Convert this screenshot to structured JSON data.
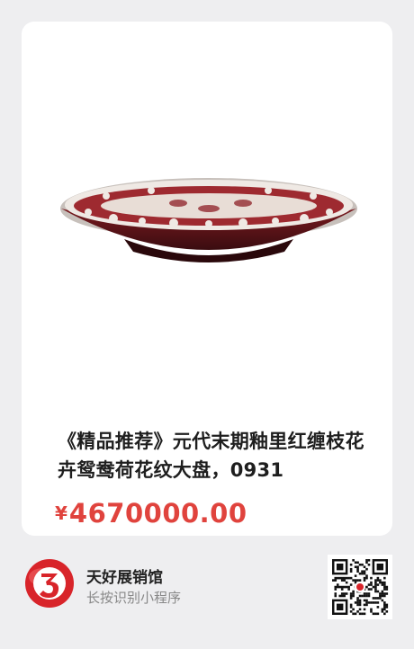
{
  "product": {
    "title": "《精品推荐》元代末期釉里红缠枝花卉鸳鸯荷花纹大盘，0931",
    "currency_symbol": "¥",
    "price": "4670000.00",
    "image_icon": "porcelain-plate-image"
  },
  "shop": {
    "name": "天好展销馆",
    "hint": "长按识别小程序",
    "logo_icon": "brand-logo-icon",
    "qr_icon": "qr-code-icon"
  },
  "colors": {
    "price": "#e0433d",
    "logo_red": "#d8242a",
    "background": "#eeeef0",
    "card": "#ffffff"
  }
}
